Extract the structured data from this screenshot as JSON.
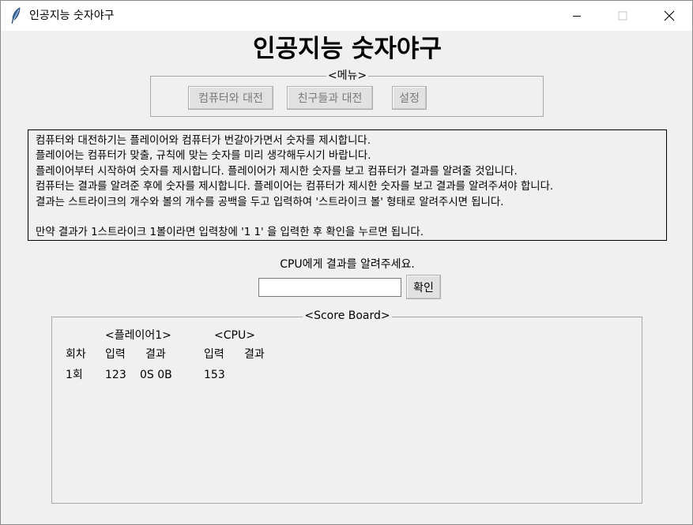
{
  "window": {
    "title": "인공지능 숫자야구",
    "minimize_glyph": "—",
    "maximize_glyph": "☐",
    "close_glyph": "✕"
  },
  "heading": "인공지능 숫자야구",
  "menu": {
    "legend": "<메뉴>",
    "buttons": {
      "vs_cpu": "컴퓨터와 대전",
      "vs_friends": "친구들과 대전",
      "settings": "설정"
    }
  },
  "instructions": [
    "컴퓨터와 대전하기는 플레이어와 컴퓨터가 번갈아가면서 숫자를 제시합니다.",
    "플레이어는 컴퓨터가 맞출, 규칙에 맞는 숫자를 미리 생각해두시기 바랍니다.",
    "플레이어부터 시작하여 숫자를 제시합니다. 플레이어가 제시한 숫자를 보고 컴퓨터가 결과를 알려줄 것입니다.",
    "컴퓨터는 결과를 알려준 후에 숫자를 제시합니다. 플레이어는 컴퓨터가 제시한 숫자를 보고 결과를 알려주셔야 합니다.",
    "결과는 스트라이크의 개수와 볼의 개수를 공백을 두고 입력하여 '스트라이크 볼' 형태로 알려주시면 됩니다.",
    "",
    "만약 결과가 1스트라이크 1볼이라면 입력창에 '1 1' 을 입력한 후 확인을 누르면 됩니다."
  ],
  "prompt": "CPU에게 결과를 알려주세요.",
  "answer_input": {
    "value": "",
    "placeholder": ""
  },
  "confirm_label": "확인",
  "scoreboard": {
    "legend": "<Score Board>",
    "player_header": "<플레이어1>",
    "cpu_header": "<CPU>",
    "columns": {
      "round": "회차",
      "player_input": "입력",
      "player_result": "결과",
      "cpu_input": "입력",
      "cpu_result": "결과"
    },
    "rows": [
      {
        "round": "1회",
        "player_input": "123",
        "player_result": "0S 0B",
        "cpu_input": "153",
        "cpu_result": ""
      }
    ]
  }
}
